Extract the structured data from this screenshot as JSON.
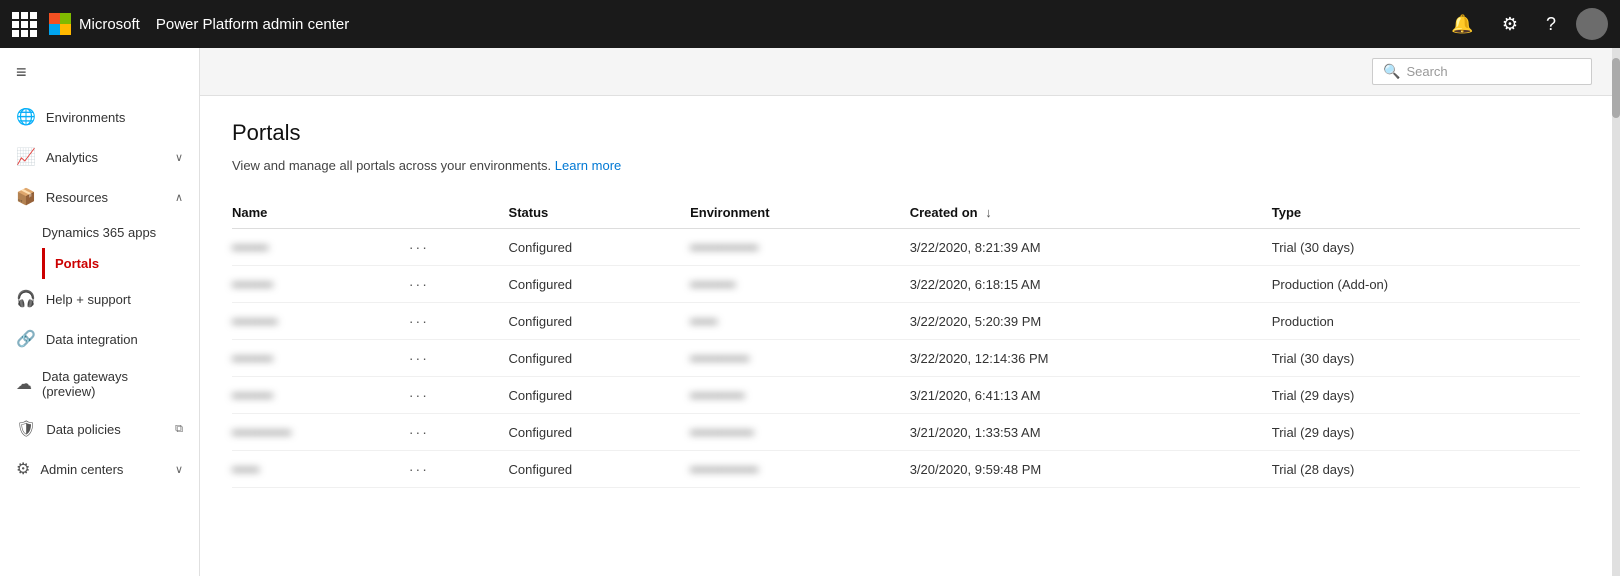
{
  "topnav": {
    "title": "Power Platform admin center",
    "search_placeholder": "Search"
  },
  "sidebar": {
    "hamburger_label": "≡",
    "items": [
      {
        "id": "environments",
        "label": "Environments",
        "icon": "🌐",
        "chevron": ""
      },
      {
        "id": "analytics",
        "label": "Analytics",
        "icon": "📈",
        "chevron": "∨"
      },
      {
        "id": "resources",
        "label": "Resources",
        "icon": "📦",
        "chevron": "∧",
        "expanded": true
      },
      {
        "id": "dynamics365apps",
        "label": "Dynamics 365 apps",
        "sub": true
      },
      {
        "id": "portals",
        "label": "Portals",
        "sub": true,
        "active": true
      },
      {
        "id": "help-support",
        "label": "Help + support",
        "icon": "🎧",
        "chevron": ""
      },
      {
        "id": "data-integration",
        "label": "Data integration",
        "icon": "🔗",
        "chevron": ""
      },
      {
        "id": "data-gateways",
        "label": "Data gateways (preview)",
        "icon": "☁",
        "chevron": ""
      },
      {
        "id": "data-policies",
        "label": "Data policies",
        "icon": "🛡",
        "chevron": "⧉"
      },
      {
        "id": "admin-centers",
        "label": "Admin centers",
        "icon": "⚙",
        "chevron": "∨"
      }
    ]
  },
  "page": {
    "title": "Portals",
    "subtitle": "View and manage all portals across your environments.",
    "learn_more": "Learn more",
    "table": {
      "columns": [
        "Name",
        "",
        "Status",
        "Environment",
        "Created on",
        "Type"
      ],
      "sort_col": "Created on",
      "rows": [
        {
          "name": "••••••••",
          "status": "Configured",
          "environment": "•••••••••••••••",
          "created": "3/22/2020, 8:21:39 AM",
          "type": "Trial (30 days)"
        },
        {
          "name": "•••••••••",
          "status": "Configured",
          "environment": "••••••••••",
          "created": "3/22/2020, 6:18:15 AM",
          "type": "Production (Add-on)"
        },
        {
          "name": "••••••••••",
          "status": "Configured",
          "environment": "••••••",
          "created": "3/22/2020, 5:20:39 PM",
          "type": "Production"
        },
        {
          "name": "•••••••••",
          "status": "Configured",
          "environment": "•••••••••••••",
          "created": "3/22/2020, 12:14:36 PM",
          "type": "Trial (30 days)"
        },
        {
          "name": "•••••••••",
          "status": "Configured",
          "environment": "••••••••••••",
          "created": "3/21/2020, 6:41:13 AM",
          "type": "Trial (29 days)"
        },
        {
          "name": "•••••••••••••",
          "status": "Configured",
          "environment": "••••••••••••••",
          "created": "3/21/2020, 1:33:53 AM",
          "type": "Trial (29 days)"
        },
        {
          "name": "••••••",
          "status": "Configured",
          "environment": "•••••••••••••••",
          "created": "3/20/2020, 9:59:48 PM",
          "type": "Trial (28 days)"
        }
      ]
    }
  }
}
